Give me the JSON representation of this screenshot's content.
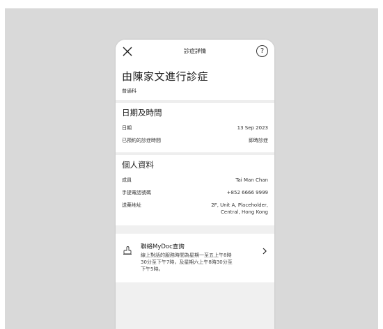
{
  "topbar": {
    "title": "診症詳情",
    "help_symbol": "?"
  },
  "consult": {
    "title": "由陳家文進行診症",
    "department": "普通科"
  },
  "datetime": {
    "heading": "日期及時間",
    "rows": [
      {
        "label": "日期",
        "value": "13 Sep 2023"
      },
      {
        "label": "已預約的診症時間",
        "value": "即時診症"
      }
    ]
  },
  "personal": {
    "heading": "個人資料",
    "rows": [
      {
        "label": "成員",
        "value": "Tai Man Chan"
      },
      {
        "label": "手提電話號碼",
        "value": "+852 6666 9999"
      },
      {
        "label": "送藥地址",
        "value_line1": "2F, Unit A, Placeholder,",
        "value_line2": "Central, Hong Kong"
      }
    ]
  },
  "contact": {
    "title": "聯絡MyDoc查詢",
    "desc": "線上對話的服務時間為星期一至五上午8時30分至下午7時，及星期六上午8時30分至下午5時。"
  }
}
